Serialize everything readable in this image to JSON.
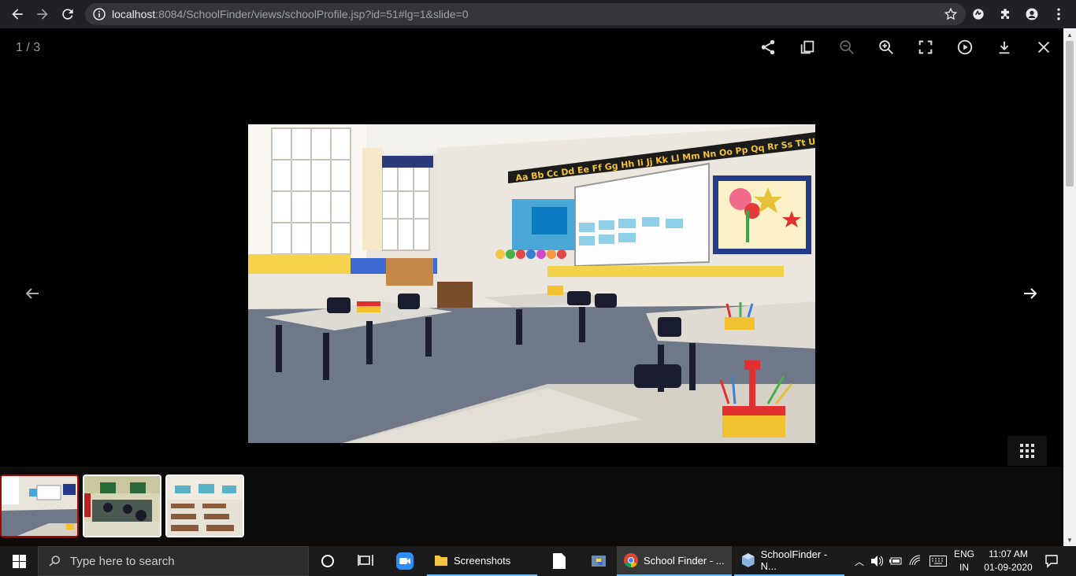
{
  "browser": {
    "url_host": "localhost",
    "url_rest": ":8084/SchoolFinder/views/schoolProfile.jsp?id=51#lg=1&slide=0"
  },
  "lightbox": {
    "counter": "1 / 3",
    "toolbar": [
      "share-icon",
      "copy-icon",
      "zoom-out-icon",
      "zoom-in-icon",
      "fullscreen-icon",
      "play-icon",
      "download-icon",
      "close-icon"
    ],
    "thumbnails": [
      "Classroom with colorful wall displays",
      "Students in classroom",
      "Classroom with rows of desks"
    ]
  },
  "taskbar": {
    "search_placeholder": "Type here to search",
    "apps": [
      {
        "label": "Screenshots"
      },
      {
        "label": "School Finder - ..."
      },
      {
        "label": "SchoolFinder - N..."
      }
    ],
    "language_top": "ENG",
    "language_bottom": "IN",
    "time": "11:07 AM",
    "date": "01-09-2020"
  },
  "colors": {
    "active_thumb_border": "#a90707",
    "browser_bar": "#202124",
    "taskbar": "#1b1b1b"
  }
}
